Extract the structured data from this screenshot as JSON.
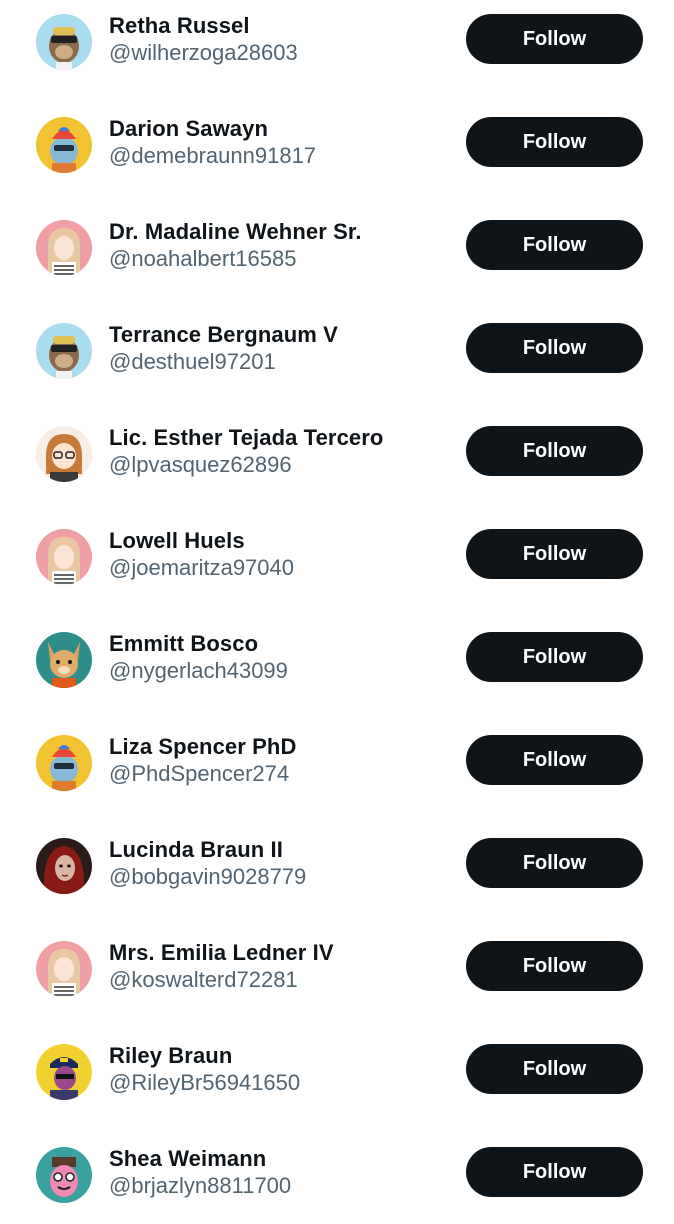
{
  "users": [
    {
      "name": "Retha Russel",
      "handle": "@wilherzoga28603",
      "avatar": "ape-avatar",
      "follow_label": "Follow"
    },
    {
      "name": "Darion Sawayn",
      "handle": "@demebraunn91817",
      "avatar": "punk-avatar",
      "follow_label": "Follow"
    },
    {
      "name": "Dr. Madaline Wehner Sr.",
      "handle": "@noahalbert16585",
      "avatar": "anime-girl-avatar",
      "follow_label": "Follow"
    },
    {
      "name": "Terrance Bergnaum V",
      "handle": "@desthuel97201",
      "avatar": "ape-avatar",
      "follow_label": "Follow"
    },
    {
      "name": "Lic. Esther Tejada Tercero",
      "handle": "@lpvasquez62896",
      "avatar": "cartoon-girl-avatar",
      "follow_label": "Follow"
    },
    {
      "name": "Lowell Huels",
      "handle": "@joemaritza97040",
      "avatar": "anime-girl-avatar",
      "follow_label": "Follow"
    },
    {
      "name": "Emmitt Bosco",
      "handle": "@nygerlach43099",
      "avatar": "dog-avatar",
      "follow_label": "Follow"
    },
    {
      "name": "Liza Spencer PhD",
      "handle": "@PhdSpencer274",
      "avatar": "punk-avatar",
      "follow_label": "Follow"
    },
    {
      "name": "Lucinda Braun II",
      "handle": "@bobgavin9028779",
      "avatar": "dark-portrait-avatar",
      "follow_label": "Follow"
    },
    {
      "name": "Mrs. Emilia Ledner IV",
      "handle": "@koswalterd72281",
      "avatar": "anime-girl-avatar",
      "follow_label": "Follow"
    },
    {
      "name": "Riley Braun",
      "handle": "@RileyBr56941650",
      "avatar": "captain-avatar",
      "follow_label": "Follow"
    },
    {
      "name": "Shea Weimann",
      "handle": "@brjazlyn8811700",
      "avatar": "pink-character-avatar",
      "follow_label": "Follow"
    }
  ]
}
